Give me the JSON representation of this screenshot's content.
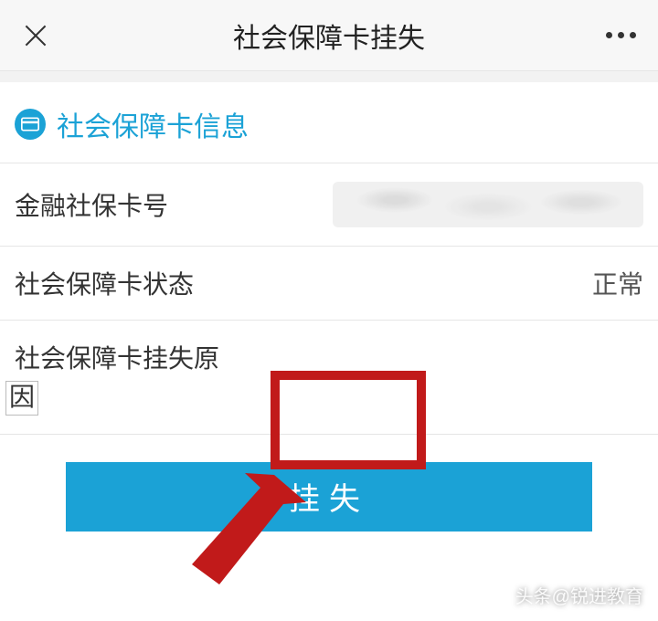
{
  "navbar": {
    "title": "社会保障卡挂失"
  },
  "section": {
    "title": "社会保障卡信息"
  },
  "fields": {
    "card_number_label": "金融社保卡号",
    "card_number_value": "",
    "status_label": "社会保障卡状态",
    "status_value": "正常",
    "reason_label_line1": "社会保障卡挂失原",
    "reason_label_line2": "因"
  },
  "button": {
    "submit": "挂失"
  },
  "watermark": {
    "text": "头条@锐进教育"
  }
}
